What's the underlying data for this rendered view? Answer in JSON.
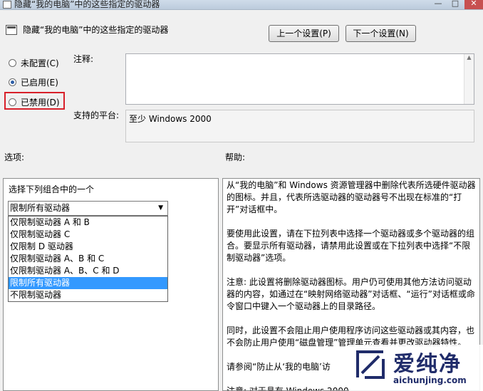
{
  "window": {
    "title": "隐藏“我的电脑”中的这些指定的驱动器",
    "min": "—",
    "max": "□",
    "close": "✕"
  },
  "header": {
    "title": "隐藏“我的电脑”中的这些指定的驱动器",
    "prev_button": "上一个设置(P)",
    "next_button": "下一个设置(N)"
  },
  "state": {
    "options": [
      {
        "label": "未配置(C)",
        "checked": false
      },
      {
        "label": "已启用(E)",
        "checked": true
      },
      {
        "label": "已禁用(D)",
        "checked": false
      }
    ]
  },
  "comment": {
    "label": "注释:",
    "value": ""
  },
  "platform": {
    "label": "支持的平台:",
    "value": "至少 Windows 2000"
  },
  "options_section": {
    "label": "选项:",
    "combo_label": "选择下列组合中的一个",
    "selected": "限制所有驱动器",
    "items": [
      {
        "label": "仅限制驱动器 A 和 B",
        "selected": false
      },
      {
        "label": "仅限制驱动器 C",
        "selected": false
      },
      {
        "label": "仅限制 D 驱动器",
        "selected": false
      },
      {
        "label": "仅限制驱动器 A、B 和 C",
        "selected": false
      },
      {
        "label": "仅限制驱动器 A、B、C 和 D",
        "selected": false
      },
      {
        "label": "限制所有驱动器",
        "selected": true
      },
      {
        "label": "不限制驱动器",
        "selected": false
      }
    ]
  },
  "help_section": {
    "label": "帮助:",
    "paragraphs": [
      "从“我的电脑”和 Windows 资源管理器中删除代表所选硬件驱动器的图标。并且，代表所选驱动器的驱动器号不出现在标准的“打开”对话框中。",
      "要使用此设置，请在下拉列表中选择一个驱动器或多个驱动器的组合。要显示所有驱动器，请禁用此设置或在下拉列表中选择“不限制驱动器”选项。",
      "注意: 此设置将删除驱动器图标。用户仍可使用其他方法访问驱动器的内容，如通过在“映射网络驱动器”对话框、“运行”对话框或命令窗口中键入一个驱动器上的目录路径。",
      "同时，此设置不会阻止用户使用程序访问这些驱动器或其内容，也不会防止用户使用“磁盘管理”管理单元查看并更改驱动器特性。",
      "请参阅“防止从‘我的电脑’访",
      "注意: 对于具有 Windows 2000"
    ]
  },
  "watermark": {
    "name": "爱纯净",
    "url": "aichunjing.com"
  },
  "colors": {
    "selection": "#3399ff",
    "highlight_box": "#d8202a",
    "watermark": "#202c6a"
  }
}
